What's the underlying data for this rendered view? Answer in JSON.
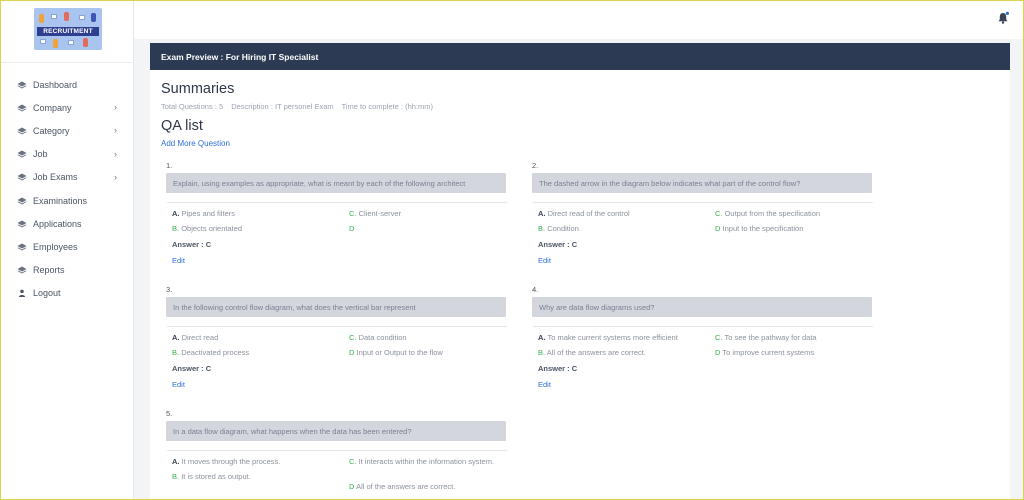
{
  "logo": {
    "text": "RECRUITMENT"
  },
  "sidebar": {
    "items": [
      {
        "label": "Dashboard",
        "chevron": false
      },
      {
        "label": "Company",
        "chevron": true
      },
      {
        "label": "Category",
        "chevron": true
      },
      {
        "label": "Job",
        "chevron": true
      },
      {
        "label": "Job Exams",
        "chevron": true
      },
      {
        "label": "Examinations",
        "chevron": false
      },
      {
        "label": "Applications",
        "chevron": false
      },
      {
        "label": "Employees",
        "chevron": false
      },
      {
        "label": "Reports",
        "chevron": false
      },
      {
        "label": "Logout",
        "chevron": false,
        "icon": "user-icon"
      }
    ]
  },
  "card": {
    "header": "Exam Preview : For Hiring IT Specialist"
  },
  "summaries": {
    "title": "Summaries",
    "total": "Total Questions : 5",
    "description": "Description : IT personel Exam",
    "time": "Time to complete : (hh:mm)"
  },
  "qa": {
    "title": "QA list",
    "add_label": "Add More Question"
  },
  "questions": [
    {
      "num": "1.",
      "text": "Explain, using examples as appropriate, what is meant by each of the following architect",
      "a": "Pipes and filters",
      "b": "Objects orientated",
      "c": "Client-server",
      "d": "",
      "answer": "Answer : C",
      "edit": "Edit"
    },
    {
      "num": "2.",
      "text": "The dashed arrow in the diagram below indicates what part of the control flow?",
      "a": "Direct read of the control",
      "b": "Condition",
      "c": "Output from the specification",
      "d": "Input to the specification",
      "answer": "Answer : C",
      "edit": "Edit"
    },
    {
      "num": "3.",
      "text": "In the following control flow diagram, what does the vertical bar represent",
      "a": "Direct read",
      "b": "Deactivated process",
      "c": "Data condition",
      "d": "Input or Output to the flow",
      "answer": "Answer : C",
      "edit": "Edit"
    },
    {
      "num": "4.",
      "text": "Why are data flow diagrams used?",
      "a": "To make current systems more efficient",
      "b": "All of the answers are correct.",
      "c": "To see the pathway for data",
      "d": "To improve current systems",
      "answer": "Answer : C",
      "edit": "Edit"
    },
    {
      "num": "5.",
      "text": "In a data flow diagram, what happens when the data has been entered?",
      "a": "It moves through the process.",
      "b": "It is stored as output.",
      "c": "It interacts within the information system.",
      "d": "All of the answers are correct.",
      "answer": "",
      "edit": ""
    }
  ],
  "option_letters": {
    "a": "A.",
    "b": "B.",
    "c": "C.",
    "d": "D"
  },
  "colors": {
    "header": "#2c3b53",
    "link": "#2f6fd6",
    "option_green": "#37b24d",
    "question_bg": "#d3d6dd"
  }
}
